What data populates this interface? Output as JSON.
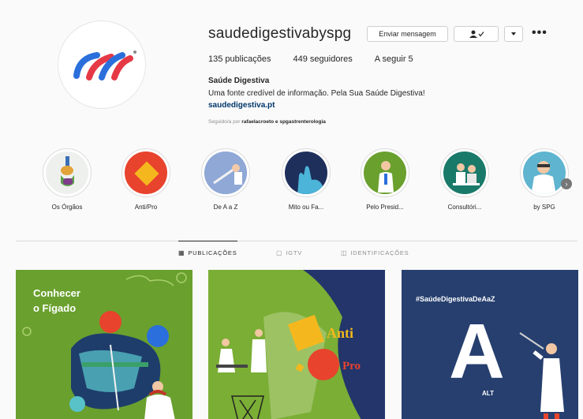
{
  "profile": {
    "username": "saudedigestivabyspg",
    "message_button": "Enviar mensagem",
    "more": "•••",
    "posts": "135 publicações",
    "followers": "449 seguidores",
    "following": "A seguir 5",
    "name": "Saúde Digestiva",
    "bio": "Uma fonte credível de informação. Pela Sua Saúde Digestiva!",
    "link": "saudedigestiva.pt",
    "followed_prefix": "Seguido/a por",
    "followed_names": "rafaelacroeto e spgastrenterologia"
  },
  "highlights": [
    {
      "label": "Os Órgãos"
    },
    {
      "label": "Anti/Pro"
    },
    {
      "label": "De A a Z"
    },
    {
      "label": "Mito ou Fa..."
    },
    {
      "label": "Pelo Presid..."
    },
    {
      "label": "Consultóri..."
    },
    {
      "label": "by SPG"
    }
  ],
  "tabs": [
    {
      "label": "PUBLICAÇÕES",
      "icon": "grid-icon"
    },
    {
      "label": "IGTV",
      "icon": "tv-icon"
    },
    {
      "label": "IDENTIFICAÇÕES",
      "icon": "tag-icon"
    }
  ],
  "posts": [
    {
      "line1": "Conhecer",
      "line2": "o Fígado"
    },
    {
      "line1": "Anti",
      "line2": "Pro"
    },
    {
      "hashtag": "#SaúdeDigestivaDeAaZ",
      "letter": "A",
      "caption": "ALT"
    }
  ],
  "colors": {
    "brand_red": "#e63946",
    "brand_blue": "#2a6fdb",
    "green": "#6aa02e",
    "navy": "#263f6f",
    "link": "#00376b"
  }
}
